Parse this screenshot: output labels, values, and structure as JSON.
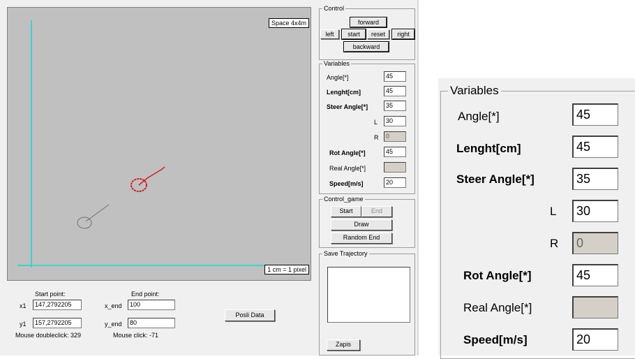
{
  "canvas": {
    "space_label": "Space 4x4m",
    "scale_label": "1 cm = 1 pixel",
    "axis_color": "#40d0d0",
    "trajectory_color": "#d02020",
    "start_shape_color": "#707070"
  },
  "bottom": {
    "start_point_label": "Start point:",
    "end_point_label": "End point:",
    "x1_label": "x1",
    "x1_value": "147,2792205",
    "y1_label": "y1",
    "y1_value": "157,2792205",
    "x_end_label": "x_end",
    "x_end_value": "100",
    "y_end_label": "y_end",
    "y_end_value": "80",
    "posli_data": "Posli Data",
    "mouse_doubleclick": "Mouse doubleclick: 329",
    "mouse_click": "Mouse click: -71"
  },
  "control": {
    "title": "Control",
    "forward": "forward",
    "left": "left",
    "start": "start",
    "reset": "reset",
    "right": "right",
    "backward": "backward"
  },
  "variables": {
    "title": "Variables",
    "angle_label": "Angle[*]",
    "angle_value": "45",
    "lenght_label": "Lenght[cm]",
    "lenght_value": "45",
    "steer_label": "Steer Angle[*]",
    "steer_value": "35",
    "l_label": "L",
    "l_value": "30",
    "r_label": "R",
    "r_value": "0",
    "rot_label": "Rot Angle[*]",
    "rot_value": "45",
    "real_label": "Real Angle[*]",
    "real_value": "",
    "speed_label": "Speed[m/s]",
    "speed_value": "20"
  },
  "control_game": {
    "title": "Control_game",
    "start": "Start",
    "end": "End",
    "draw": "Draw",
    "random_end": "Random End"
  },
  "save": {
    "title": "Save Trajectory",
    "zapis": "Zapis"
  }
}
